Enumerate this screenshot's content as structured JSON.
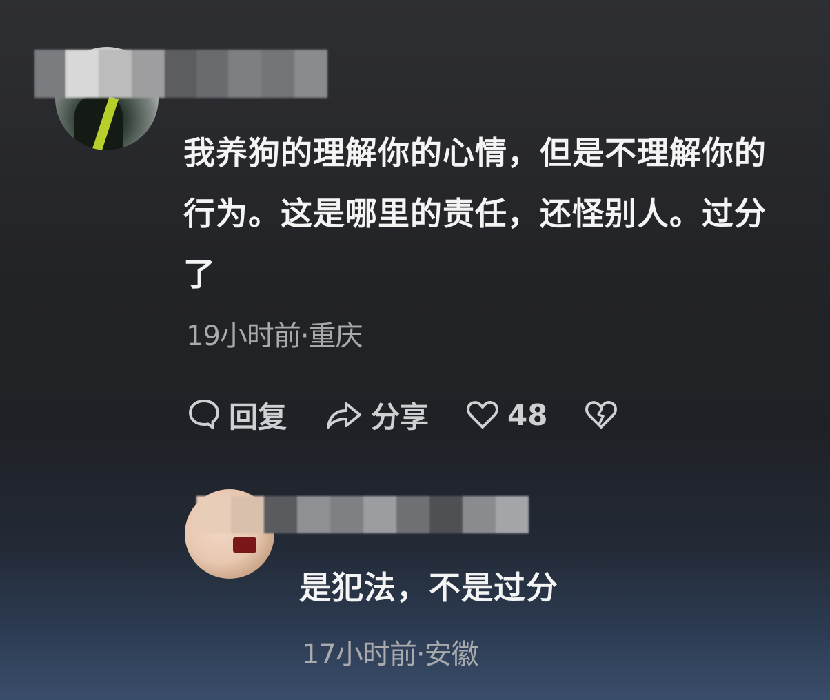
{
  "comments": [
    {
      "text": "我养狗的理解你的心情，但是不理解你的行为。这是哪里的责任，还怪别人。过分了",
      "meta": "19小时前·重庆",
      "actions": {
        "reply_label": "回复",
        "share_label": "分享",
        "like_count": "48"
      },
      "icons": [
        "comment-icon",
        "share-icon",
        "heart-icon",
        "broken-heart-icon"
      ]
    },
    {
      "text": "是犯法，不是过分",
      "meta": "17小时前·安徽"
    }
  ],
  "colors": {
    "text": "#f4f4f4",
    "meta": "#a9aaad",
    "action": "#cfd0d2"
  }
}
